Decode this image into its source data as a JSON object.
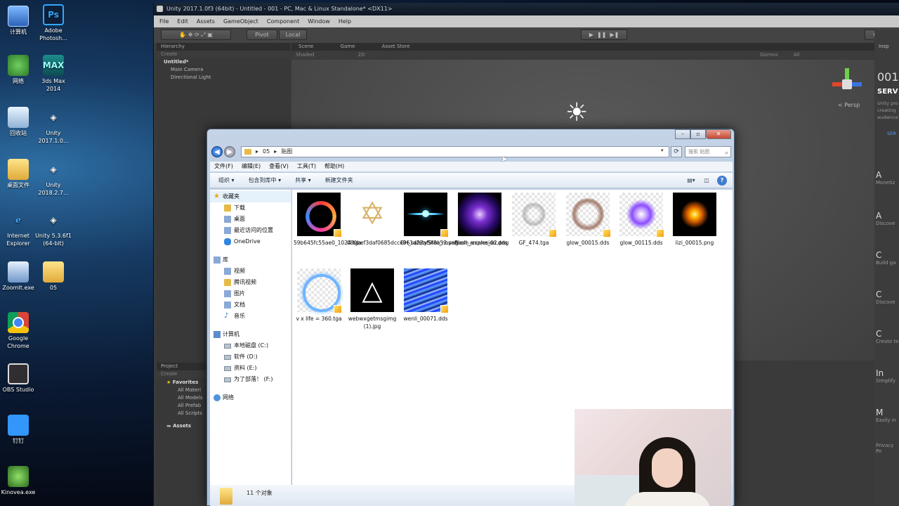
{
  "desktop": {
    "col1": [
      {
        "label": "计算机",
        "icon": "computer-icon"
      },
      {
        "label": "网络",
        "icon": "network-icon"
      },
      {
        "label": "回收站",
        "icon": "recycle-bin-icon"
      },
      {
        "label": "桌面文件",
        "icon": "folder-icon"
      },
      {
        "label": "Internet Explorer",
        "icon": "ie-icon"
      },
      {
        "label": "ZoomIt.exe",
        "icon": "zoomit-icon"
      },
      {
        "label": "Google Chrome",
        "icon": "chrome-icon"
      },
      {
        "label": "OBS Studio",
        "icon": "obs-icon"
      },
      {
        "label": "钉钉",
        "icon": "dingtalk-icon"
      },
      {
        "label": "Kinovea.exe",
        "icon": "kinovea-icon"
      }
    ],
    "col2": [
      {
        "label": "Adobe Photosh...",
        "icon": "photoshop-icon",
        "glyph": "Ps"
      },
      {
        "label": "3ds Max 2014",
        "icon": "3dsmax-icon",
        "glyph": "MAX"
      },
      {
        "label": "Unity 2017.1.0...",
        "icon": "unity-icon"
      },
      {
        "label": "Unity 2018.2.7...",
        "icon": "unity-icon"
      },
      {
        "label": "Unity 5.3.6f1 (64-bit)",
        "icon": "unity-icon"
      },
      {
        "label": "05",
        "icon": "folder-icon"
      }
    ]
  },
  "unity": {
    "title": "Unity 2017.1.0f3 (64bit) - Untitled - 001 - PC, Mac & Linux Standalone* <DX11>",
    "menu": [
      "File",
      "Edit",
      "Assets",
      "GameObject",
      "Component",
      "Window",
      "Help"
    ],
    "pivot": "Pivot",
    "local": "Local",
    "collab": "Collab",
    "hierarchy": {
      "title": "Hierarchy",
      "create": "Create",
      "search": "All",
      "scene": "Untitled*",
      "items": [
        "Main Camera",
        "Directional Light"
      ]
    },
    "tabs": {
      "scene": "Scene",
      "game": "Game",
      "asset_store": "Asset Store"
    },
    "scene_bar": {
      "shaded": "Shaded",
      "mode2d": "2D",
      "gizmos": "Gizmos",
      "all": "All"
    },
    "persp": "< Persp",
    "project": {
      "title": "Project",
      "create": "Create",
      "favorites": "Favorites",
      "items": [
        "All Materi",
        "All Models",
        "All Prefab",
        "All Scripts"
      ],
      "assets": "Assets"
    },
    "inspector": {
      "tab": "Insp",
      "big": "001",
      "heading": "SERV",
      "desc": [
        "Unity pro",
        "creating",
        "audience"
      ],
      "link": "SER"
    },
    "services": [
      {
        "glyph": "A",
        "desc": "Monetiz"
      },
      {
        "glyph": "A",
        "desc": "Discove"
      },
      {
        "glyph": "C",
        "desc": "Build ga"
      },
      {
        "glyph": "C",
        "desc": "Discove"
      },
      {
        "glyph": "C",
        "desc": "Create te"
      },
      {
        "glyph": "In",
        "desc": "Simplify"
      },
      {
        "glyph": "M",
        "desc": "Easily in"
      }
    ],
    "privacy": "Privacy Po"
  },
  "explorer": {
    "path": [
      "05",
      "贴图"
    ],
    "search_placeholder": "搜索 贴图",
    "menu": [
      "文件(F)",
      "编辑(E)",
      "查看(V)",
      "工具(T)",
      "帮助(H)"
    ],
    "commands": [
      "组织 ▾",
      "包含到库中 ▾",
      "共享 ▾",
      "新建文件夹"
    ],
    "nav": {
      "favorites": "收藏夹",
      "fav_items": [
        "下载",
        "桌面",
        "最近访问的位置",
        "OneDrive"
      ],
      "libraries": "库",
      "lib_items": [
        "视频",
        "腾讯视频",
        "图片",
        "文档",
        "音乐"
      ],
      "computer": "计算机",
      "drives": [
        "本地磁盘 (C:)",
        "软件 (D:)",
        "资料 (E:)",
        "为了部落！ (F:)"
      ],
      "network": "网络"
    },
    "files": [
      {
        "name": "59b645fc55ae0_1024.tga"
      },
      {
        "name": "080bef3daf0685dcce961d22af5f8a53.png"
      },
      {
        "name": "DH_safetyShot_novaFlash_explosion.dds"
      },
      {
        "name": "flash_arcane_02.png"
      },
      {
        "name": "GF_474.tga"
      },
      {
        "name": "glow_00015.dds"
      },
      {
        "name": "glow_00115.dds"
      },
      {
        "name": "lizi_00015.png"
      },
      {
        "name": "v x life = 360.tga"
      },
      {
        "name": "webwxgetmsgimg (1).jpg"
      },
      {
        "name": "wenli_00071.dds"
      }
    ],
    "status": "11 个对象"
  }
}
